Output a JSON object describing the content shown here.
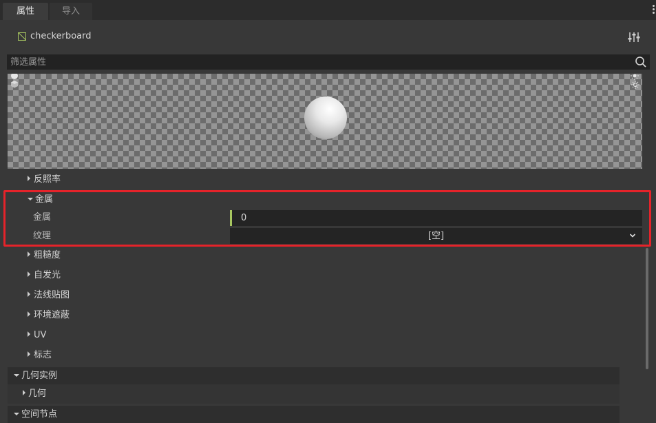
{
  "tabs": [
    {
      "label": "属性",
      "active": true
    },
    {
      "label": "导入",
      "active": false
    }
  ],
  "resource": {
    "name": "checkerboard",
    "icon": "texture-icon"
  },
  "filter": {
    "placeholder": "筛选属性"
  },
  "sections": {
    "albedo": "反照率",
    "metallic": "金属",
    "roughness": "粗糙度",
    "emission": "自发光",
    "normal_map": "法线贴图",
    "ambient_occlusion": "环境遮蔽",
    "uv": "UV",
    "flags": "标志"
  },
  "metallic_props": {
    "metallic_label": "金属",
    "metallic_value": "0",
    "texture_label": "纹理",
    "texture_value": "[空]"
  },
  "groups": {
    "geometry_instance": "几何实例",
    "geometry": "几何",
    "spatial": "空间节点"
  },
  "colors": {
    "accent": "#a7c660",
    "highlight": "#e5232a"
  }
}
